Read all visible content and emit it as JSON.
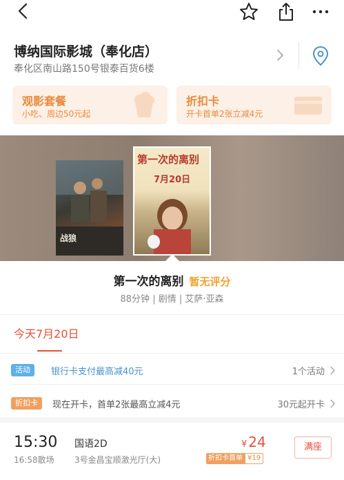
{
  "topbar": {
    "icons": [
      "back-icon",
      "star-icon",
      "share-icon",
      "more-icon"
    ]
  },
  "cinema": {
    "name": "博纳国际影城（奉化店）",
    "address": "奉化区南山路150号银泰百货6楼"
  },
  "promos": [
    {
      "title": "观影套餐",
      "subtitle": "小吃、周边50元起"
    },
    {
      "title": "折扣卡",
      "subtitle": "开卡首单2张立减4元"
    }
  ],
  "posters": {
    "poster1_text": "战狼",
    "poster2_title": "第一次的离别",
    "poster2_date": "7月20日"
  },
  "movie": {
    "title": "第一次的离别",
    "score": "暂无评分",
    "meta": "88分钟 | 剧情 | 艾萨·亚森"
  },
  "date_tab": "今天7月20日",
  "activities": [
    {
      "badge": "活动",
      "text": "银行卡支付最高减40元",
      "right": "1个活动"
    },
    {
      "badge": "折扣卡",
      "text": "现在开卡，首单2张最高立减4元",
      "right": "30元起开卡"
    }
  ],
  "showtime": {
    "start": "15:30",
    "end": "16:58散场",
    "lang": "国语2D",
    "hall": "3号金昌宝顺激光厅(大)",
    "currency": "¥",
    "price": "24",
    "card_label": "折扣卡首单",
    "card_price": "¥19",
    "button": "满座"
  },
  "colors": {
    "accent_red": "#e4503c",
    "promo_orange": "#e98a3c",
    "promo_bg": "#fdf0e6",
    "activity_blue": "#5fb0e6",
    "score_yellow": "#f0a22f"
  }
}
